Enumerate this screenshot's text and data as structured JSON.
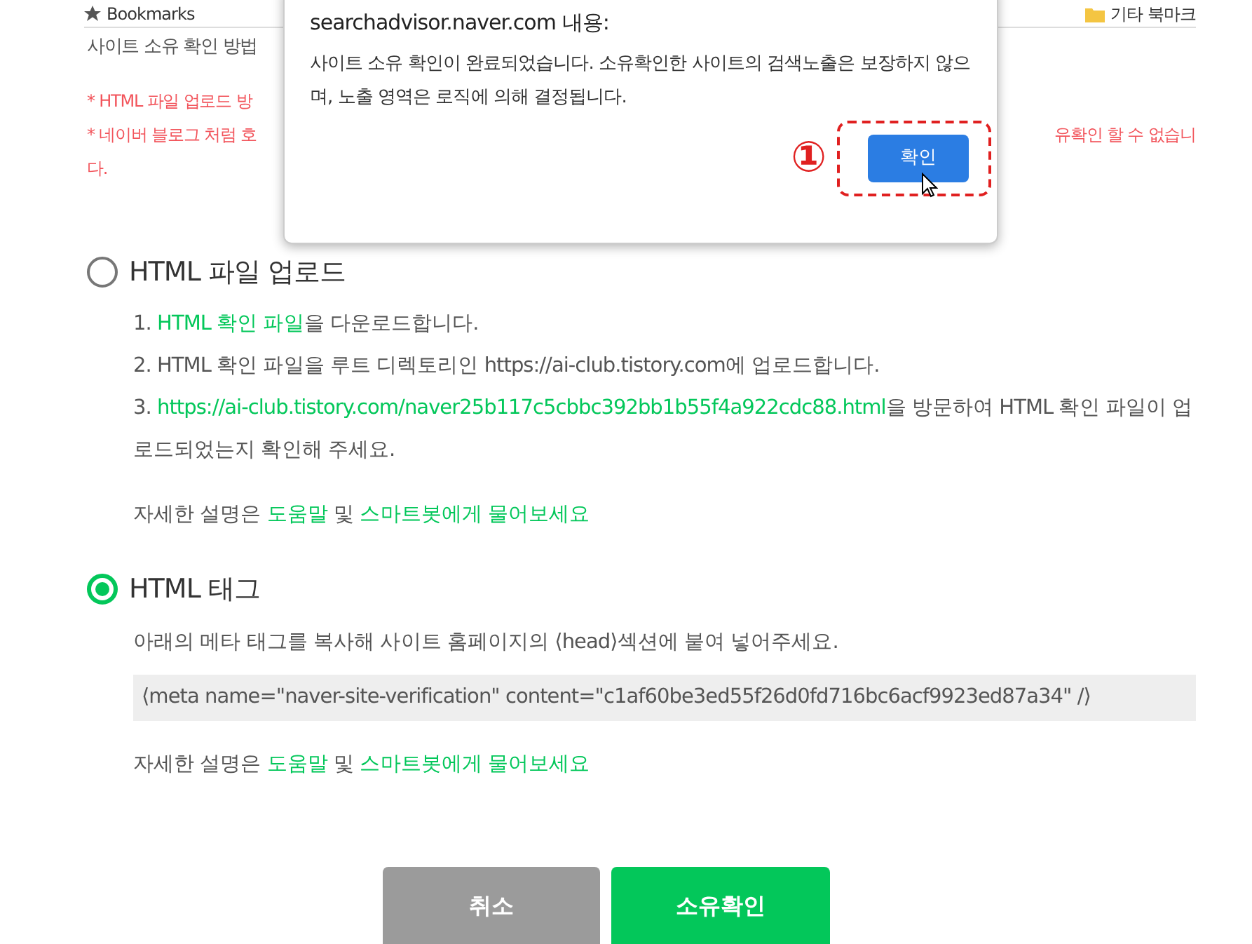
{
  "bookmarks_bar": {
    "items": [
      {
        "label": "Bookmarks"
      },
      {
        "label": "기타 북마크"
      }
    ]
  },
  "page": {
    "title": "사이트 소유 확인 방법",
    "notices": [
      {
        "fragments": [
          "* HTML 파일 업로드 방"
        ]
      },
      {
        "fragments": [
          "* 네이버 블로그 처럼 호",
          "유확인 할 수 없습니"
        ]
      },
      {
        "fragments": [
          "다."
        ]
      }
    ],
    "methods": [
      {
        "label": "HTML 파일 업로드",
        "selected": false,
        "steps": [
          [
            {
              "text": "1. ",
              "link": false
            },
            {
              "text": "HTML 확인 파일",
              "link": true
            },
            {
              "text": "을 다운로드합니다.",
              "link": false
            }
          ],
          [
            {
              "text": "2. HTML 확인 파일을 루트 디렉토리인 https://ai-club.tistory.com에 업로드합니다.",
              "link": false
            }
          ],
          [
            {
              "text": "3. ",
              "link": false
            },
            {
              "text": "https://ai-club.tistory.com/naver25b117c5cbbc392bb1b55f4a922cdc88.html",
              "link": true
            },
            {
              "text": "을 방문하여 HTML 확인 파일이 업로드되었는지 확인해 주세요.",
              "link": false
            }
          ]
        ],
        "help": [
          {
            "text": "자세한 설명은 ",
            "link": false
          },
          {
            "text": "도움말",
            "link": true
          },
          {
            "text": " 및 ",
            "link": false
          },
          {
            "text": "스마트봇에게 물어보세요",
            "link": true
          }
        ]
      },
      {
        "label": "HTML 태그",
        "selected": true,
        "description": "아래의 메타 태그를 복사해 사이트 홈페이지의 ⟨head⟩섹션에 붙여 넣어주세요.",
        "code": "⟨meta name=\"naver-site-verification\" content=\"c1af60be3ed55f26d0fd716bc6acf9923ed87a34\" /⟩",
        "help": [
          {
            "text": "자세한 설명은 ",
            "link": false
          },
          {
            "text": "도움말",
            "link": true
          },
          {
            "text": " 및 ",
            "link": false
          },
          {
            "text": "스마트봇에게 물어보세요",
            "link": true
          }
        ]
      }
    ],
    "buttons": [
      {
        "label": "취소",
        "kind": "cancel"
      },
      {
        "label": "소유확인",
        "kind": "primary"
      }
    ]
  },
  "dialog": {
    "origin": "searchadvisor.naver.com 내용:",
    "message": "사이트 소유 확인이 완료되었습니다. 소유확인한 사이트의 검색노출은 보장하지 않으며, 노출 영역은 로직에 의해 결정됩니다.",
    "button": "확인",
    "annotation": "①"
  }
}
